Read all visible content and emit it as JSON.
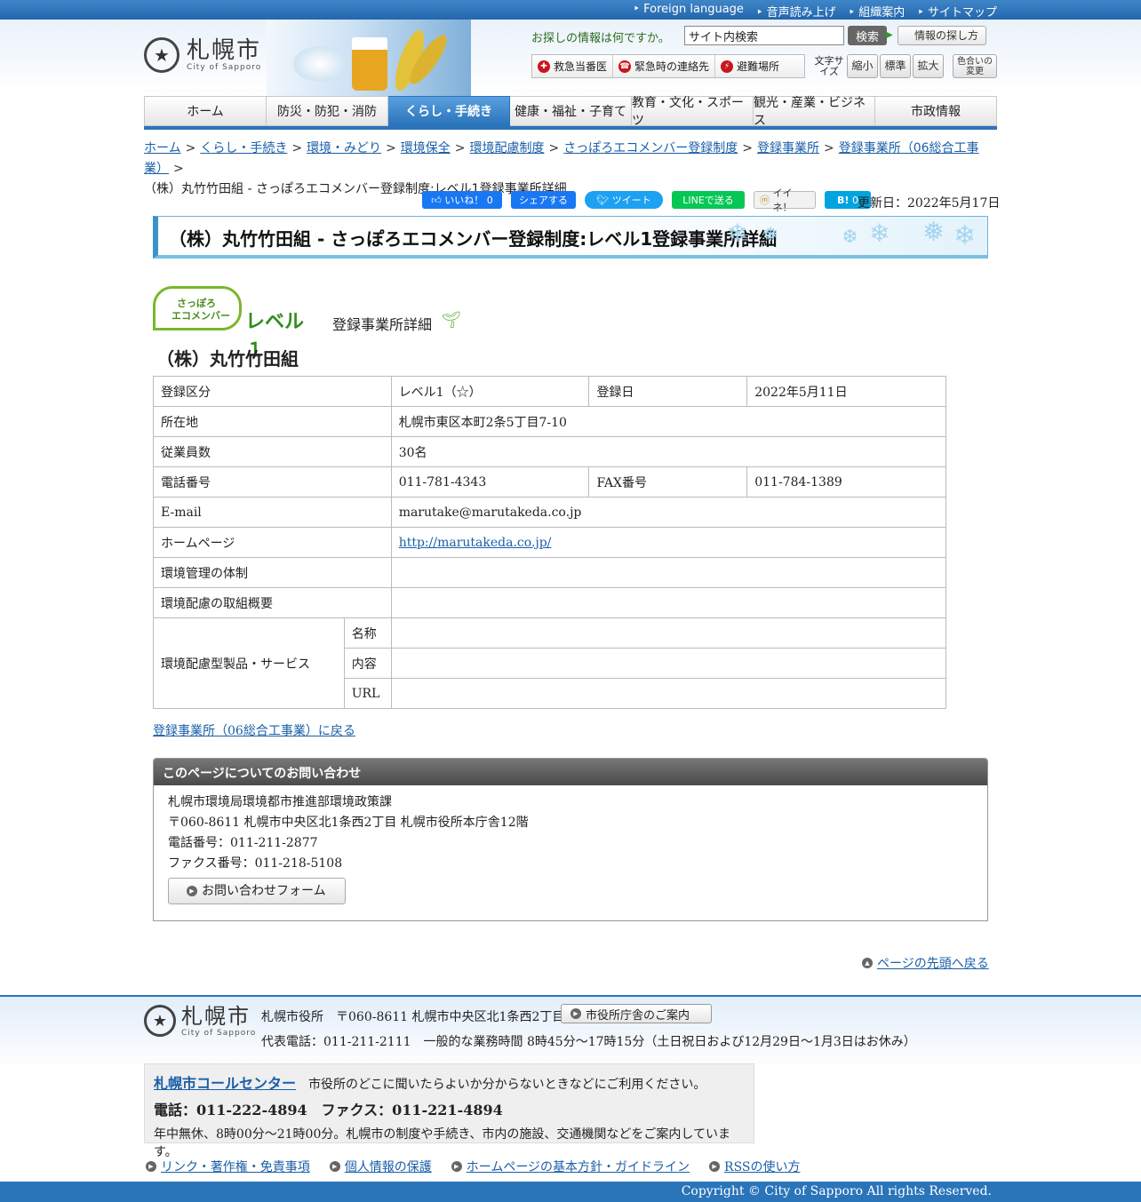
{
  "top_links": [
    "Foreign language",
    "音声読み上げ",
    "組織案内",
    "サイトマップ"
  ],
  "logo": {
    "kanji": "札幌市",
    "en": "City of Sapporo"
  },
  "search": {
    "label": "お探しの情報は何ですか。",
    "value": "サイト内検索",
    "button": "検索",
    "howto": "情報の探し方"
  },
  "emergency": [
    "救急当番医",
    "緊急時の連絡先",
    "避難場所"
  ],
  "font_size": {
    "label": "文字サイズ",
    "small": "縮小",
    "normal": "標準",
    "large": "拡大"
  },
  "color_change": "色合いの変更",
  "nav": [
    {
      "label": "ホーム",
      "active": false
    },
    {
      "label": "防災・防犯・消防",
      "active": false
    },
    {
      "label": "くらし・手続き",
      "active": true
    },
    {
      "label": "健康・福祉・子育て",
      "active": false
    },
    {
      "label": "教育・文化・スポーツ",
      "active": false
    },
    {
      "label": "観光・産業・ビジネス",
      "active": false
    },
    {
      "label": "市政情報",
      "active": false
    }
  ],
  "breadcrumb": {
    "links": [
      "ホーム",
      "くらし・手続き",
      "環境・みどり",
      "環境保全",
      "環境配慮制度",
      "さっぽろエコメンバー登録制度",
      "登録事業所",
      "登録事業所（06総合工事業）"
    ],
    "current": "（株）丸竹竹田組 - さっぽろエコメンバー登録制度:レベル1登録事業所詳細"
  },
  "social": {
    "like": "いいね！ 0",
    "share": "シェアする",
    "tweet": "ツイート",
    "line": "LINEで送る",
    "mixi": "イイネ！",
    "hatena": "0"
  },
  "updated": "更新日：2022年5月17日",
  "page_title": "（株）丸竹竹田組 - さっぽろエコメンバー登録制度:レベル1登録事業所詳細",
  "eco": {
    "badge_line1": "さっぽろ",
    "badge_line2": "エコメンバー",
    "level": "レベル１",
    "subtitle": "登録事業所詳細"
  },
  "company_name": "（株）丸竹竹田組",
  "details": {
    "reg_class_label": "登録区分",
    "reg_class": "レベル1（☆）",
    "reg_date_label": "登録日",
    "reg_date": "2022年5月11日",
    "address_label": "所在地",
    "address": "札幌市東区本町2条5丁目7-10",
    "employees_label": "従業員数",
    "employees": "30名",
    "phone_label": "電話番号",
    "phone": "011-781-4343",
    "fax_label": "FAX番号",
    "fax": "011-784-1389",
    "email_label": "E-mail",
    "email": "marutake@marutakeda.co.jp",
    "homepage_label": "ホームページ",
    "homepage": "http://marutakeda.co.jp/",
    "env_system_label": "環境管理の体制",
    "env_system": "",
    "env_summary_label": "環境配慮の取組概要",
    "env_summary": "",
    "product_label": "環境配慮型製品・サービス",
    "product_name_label": "名称",
    "product_name": "",
    "product_content_label": "内容",
    "product_content": "",
    "product_url_label": "URL",
    "product_url": ""
  },
  "back_link": "登録事業所（06総合工事業）に戻る",
  "contact": {
    "heading": "このページについてのお問い合わせ",
    "dept": "札幌市環境局環境都市推進部環境政策課",
    "address": "〒060-8611 札幌市中央区北1条西2丁目 札幌市役所本庁舎12階",
    "phone": "電話番号：011-211-2877",
    "fax": "ファクス番号：011-218-5108",
    "form_button": "お問い合わせフォーム"
  },
  "page_top": "ページの先頭へ戻る",
  "footer": {
    "address": "札幌市役所　〒060-8611 札幌市中央区北1条西2丁目",
    "building_button": "市役所庁舎のご案内",
    "hours": "代表電話：011-211-2111　一般的な業務時間 8時45分～17時15分（土日祝日および12月29日～1月3日はお休み）",
    "call_center_link": "札幌市コールセンター",
    "call_center_desc": "市役所のどこに聞いたらよいか分からないときなどにご利用ください。",
    "call_center_tel": "電話：011-222-4894　ファクス：011-221-4894",
    "call_center_info": "年中無休、8時00分～21時00分。札幌市の制度や手続き、市内の施設、交通機関などをご案内しています。",
    "links": [
      "リンク・著作権・免責事項",
      "個人情報の保護",
      "ホームページの基本方針・ガイドライン",
      "RSSの使い方"
    ],
    "copyright": "Copyright © City of Sapporo All rights Reserved."
  }
}
